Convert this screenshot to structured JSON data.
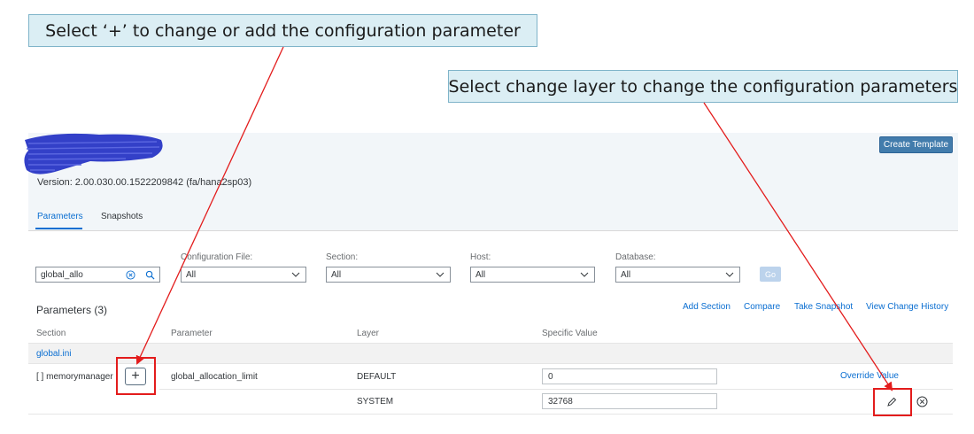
{
  "annotations": {
    "add_param_note": "Select ‘+’ to change or add the configuration parameter",
    "change_layer_note": "Select change layer to change the configuration parameters"
  },
  "header": {
    "version": "Version: 2.00.030.00.1522209842 (fa/hana2sp03)",
    "create_template_label": "Create Template"
  },
  "tabs": [
    {
      "label": "Parameters",
      "active": true
    },
    {
      "label": "Snapshots",
      "active": false
    }
  ],
  "filters": {
    "search_value": "global_allo",
    "configuration_file": {
      "label": "Configuration File:",
      "value": "All"
    },
    "section": {
      "label": "Section:",
      "value": "All"
    },
    "host": {
      "label": "Host:",
      "value": "All"
    },
    "database": {
      "label": "Database:",
      "value": "All"
    },
    "go_label": "Go"
  },
  "toolbar": {
    "title": "Parameters (3)",
    "add_section": "Add Section",
    "compare": "Compare",
    "take_snapshot": "Take Snapshot",
    "view_change_history": "View Change History"
  },
  "table": {
    "columns": [
      "Section",
      "Parameter",
      "Layer",
      "Specific Value"
    ],
    "group": "global.ini",
    "section": "[ ] memorymanager",
    "parameter": "global_allocation_limit",
    "add_glyph": "+",
    "rows": [
      {
        "layer": "DEFAULT",
        "value": "0",
        "action": "Override Value"
      },
      {
        "layer": "SYSTEM",
        "value": "32768"
      }
    ]
  },
  "colors": {
    "accent": "#0a6ed1",
    "annotation_red": "#e31c1c",
    "callout_fill": "#dbeef4"
  }
}
